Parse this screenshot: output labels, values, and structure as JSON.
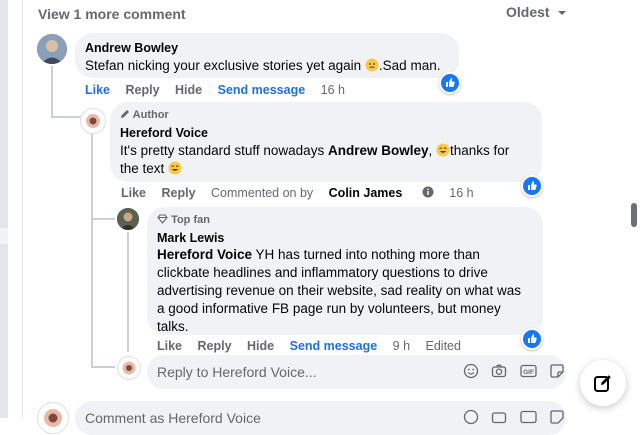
{
  "header": {
    "view_more": "View 1 more comment",
    "sort_label": "Oldest"
  },
  "comment1": {
    "author": "Andrew Bowley",
    "text": "Stefan nicking your exclusive stories yet again",
    "text_after_emoji": ".Sad man.",
    "actions": {
      "like": "Like",
      "reply": "Reply",
      "hide": "Hide",
      "send": "Send message",
      "time": "16 h"
    }
  },
  "comment2": {
    "badge": "Author",
    "author": "Hereford Voice",
    "text_before": "It's pretty standard stuff nowadays",
    "mention": "Andrew Bowley",
    "text_after": ",",
    "text_after2": "thanks for",
    "text_line2": "the text",
    "actions": {
      "like": "Like",
      "reply": "Reply",
      "commented_prefix": "Commented on by",
      "commented_name": "Colin James",
      "time": "16 h"
    }
  },
  "comment3": {
    "badge": "Top fan",
    "author": "Mark Lewis",
    "mention": "Hereford Voice",
    "lines": [
      "YH has turned into nothing more than",
      "clickbate headlines and inflammatory questions to drive",
      "advertising revenue on their website, sad reality on what was",
      "a good informative FB page run by volunteers, but money",
      "talks."
    ],
    "actions": {
      "like": "Like",
      "reply": "Reply",
      "hide": "Hide",
      "send": "Send message",
      "time": "9 h",
      "edited": "Edited"
    }
  },
  "reply_box": {
    "placeholder": "Reply to Hereford Voice..."
  },
  "comment_box": {
    "placeholder": "Comment as Hereford Voice"
  },
  "colors": {
    "link_blue": "#216fdb",
    "bubble": "#f0f2f5",
    "like_blue": "#1877f2"
  }
}
